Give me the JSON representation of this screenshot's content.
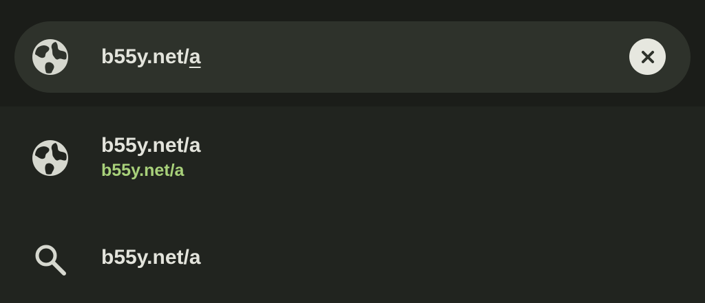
{
  "omnibox": {
    "icon": "globe-icon",
    "url_text": "b55y.net/",
    "url_cursor_char": "a",
    "clear_icon": "close-icon"
  },
  "suggestions": [
    {
      "icon": "globe-icon",
      "title": "b55y.net/a",
      "url": "b55y.net/a"
    },
    {
      "icon": "search-icon",
      "title": "b55y.net/a"
    }
  ],
  "colors": {
    "background": "#21241f",
    "top_bar": "#1b1d19",
    "url_field": "#2e322b",
    "text": "#e3e4dc",
    "url_accent": "#a8d17a",
    "icon": "#d6d8cf"
  }
}
